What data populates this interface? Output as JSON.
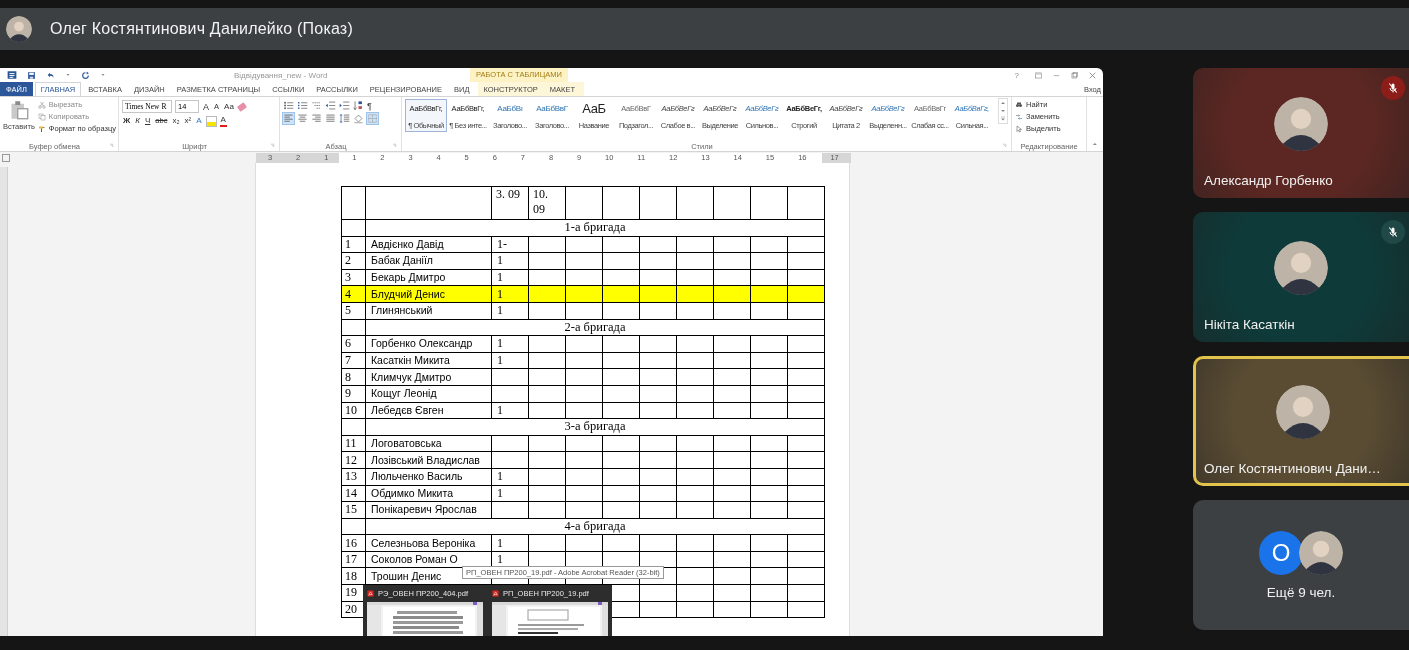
{
  "presenter_bar": {
    "title": "Олег Костянтинович Данилейко (Показ)"
  },
  "word": {
    "title": "Відвідування_new - Word",
    "context_group": "РАБОТА С ТАБЛИЦАМИ",
    "help": "?",
    "sign_in": "Вход",
    "tabs": [
      {
        "label": "ФАЙЛ",
        "kind": "file",
        "selected": false
      },
      {
        "label": "ГЛАВНАЯ",
        "kind": "normal",
        "selected": true
      },
      {
        "label": "ВСТАВКА",
        "kind": "normal",
        "selected": false
      },
      {
        "label": "ДИЗАЙН",
        "kind": "normal",
        "selected": false
      },
      {
        "label": "РАЗМЕТКА СТРАНИЦЫ",
        "kind": "normal",
        "selected": false
      },
      {
        "label": "ССЫЛКИ",
        "kind": "normal",
        "selected": false
      },
      {
        "label": "РАССЫЛКИ",
        "kind": "normal",
        "selected": false
      },
      {
        "label": "РЕЦЕНЗИРОВАНИЕ",
        "kind": "normal",
        "selected": false
      },
      {
        "label": "ВИД",
        "kind": "normal",
        "selected": false
      },
      {
        "label": "КОНСТРУКТОР",
        "kind": "context",
        "selected": false
      },
      {
        "label": "МАКЕТ",
        "kind": "context",
        "selected": false
      }
    ],
    "clipboard": {
      "paste": "Вставить",
      "cut": "Вырезать",
      "copy": "Копировать",
      "format_painter": "Формат по образцу",
      "label": "Буфер обмена"
    },
    "font": {
      "name": "Times New R",
      "size": "14",
      "label": "Шрифт",
      "top_buttons": [
        {
          "label": "A",
          "kind": "grow"
        },
        {
          "label": "A",
          "kind": "shrink"
        },
        {
          "label": "Аа",
          "kind": "case"
        }
      ],
      "buttons": [
        {
          "label": "Ж",
          "kind": "bold"
        },
        {
          "label": "К",
          "kind": "italic"
        },
        {
          "label": "Ч",
          "kind": "underline"
        },
        {
          "label": "abc",
          "kind": "strike"
        },
        {
          "label": "x₂",
          "kind": "sub"
        },
        {
          "label": "x²",
          "kind": "sup"
        },
        {
          "label": "A",
          "kind": "effects"
        },
        {
          "label": "A",
          "kind": "color"
        }
      ]
    },
    "paragraph": {
      "label": "Абзац",
      "pilcrow": "¶"
    },
    "styles": {
      "label": "Стили",
      "items": [
        {
          "sample": "АаБбВвГг,",
          "name": "¶ Обычный",
          "selected": true,
          "kind": "plain"
        },
        {
          "sample": "АаБбВвГг,",
          "name": "¶ Без инте...",
          "selected": false,
          "kind": "plain"
        },
        {
          "sample": "АаБбВı",
          "name": "Заголово...",
          "selected": false,
          "kind": "heading"
        },
        {
          "sample": "АаБбВвГ",
          "name": "Заголово...",
          "selected": false,
          "kind": "heading"
        },
        {
          "sample": "АаБ",
          "name": "Название",
          "selected": false,
          "kind": "title"
        },
        {
          "sample": "АаБбВвГ",
          "name": "Подзагол...",
          "selected": false,
          "kind": "subtle"
        },
        {
          "sample": "АаБбВеГг",
          "name": "Слабое в...",
          "selected": false,
          "kind": "italic"
        },
        {
          "sample": "АаБбВеГг",
          "name": "Выделение",
          "selected": false,
          "kind": "italic"
        },
        {
          "sample": "АаБбВеГг",
          "name": "Сильнов...",
          "selected": false,
          "kind": "accent"
        },
        {
          "sample": "АаБбВеГг,",
          "name": "Строгий",
          "selected": false,
          "kind": "strong"
        },
        {
          "sample": "АаБбВеГг",
          "name": "Цитата 2",
          "selected": false,
          "kind": "italic"
        },
        {
          "sample": "АаБбВеГг",
          "name": "Выделенн...",
          "selected": false,
          "kind": "accent"
        },
        {
          "sample": "АаБбВвГг",
          "name": "Слабая сс...",
          "selected": false,
          "kind": "subtle"
        },
        {
          "sample": "АаБбВвГг,",
          "name": "Сильная...",
          "selected": false,
          "kind": "accent"
        }
      ]
    },
    "editing": {
      "find": "Найти",
      "replace": "Заменить",
      "select": "Выделить",
      "label": "Редактирование"
    },
    "ruler": [
      "3",
      "2",
      "1",
      "1",
      "2",
      "3",
      "4",
      "5",
      "6",
      "7",
      "8",
      "9",
      "10",
      "11",
      "12",
      "13",
      "14",
      "15",
      "16",
      "17"
    ],
    "table": {
      "date_columns": [
        {
          "kind": "date",
          "label": "3. 09"
        },
        {
          "kind": "date",
          "label": "10. 09"
        },
        {
          "kind": "blank"
        },
        {
          "kind": "blank"
        },
        {
          "kind": "blank"
        },
        {
          "kind": "blank"
        },
        {
          "kind": "blank"
        },
        {
          "kind": "blank"
        },
        {
          "kind": "blank"
        }
      ],
      "rows": [
        {
          "kind": "group",
          "title": "1-а бригада"
        },
        {
          "kind": "student",
          "number": "1",
          "name": "Авдієнко Давід",
          "mark": "1-",
          "highlighted": false
        },
        {
          "kind": "student",
          "number": "2",
          "name": "Бабак Даніїл",
          "mark": "1",
          "highlighted": false
        },
        {
          "kind": "student",
          "number": "3",
          "name": "Бекарь Дмитро",
          "mark": "1",
          "highlighted": false
        },
        {
          "kind": "student",
          "number": "4",
          "name": "Блудчий Денис",
          "mark": "1",
          "highlighted": true
        },
        {
          "kind": "student",
          "number": "5",
          "name": "Глинянський",
          "mark": "1",
          "highlighted": false
        },
        {
          "kind": "group",
          "title": "2-а бригада"
        },
        {
          "kind": "student",
          "number": "6",
          "name": "Горбенко Олександр",
          "mark": "1",
          "highlighted": false
        },
        {
          "kind": "student",
          "number": "7",
          "name": "Касаткін Микита",
          "mark": "1",
          "highlighted": false
        },
        {
          "kind": "student",
          "number": "8",
          "name": "Климчук Дмитро",
          "highlighted": false
        },
        {
          "kind": "student",
          "number": "9",
          "name": "Кощуг Леонід",
          "highlighted": false
        },
        {
          "kind": "student",
          "number": "10",
          "name": "Лебедєв Євген",
          "mark": "1",
          "highlighted": false
        },
        {
          "kind": "group",
          "title": "3-а бригада"
        },
        {
          "kind": "student",
          "number": "11",
          "name": "Логоватовська",
          "highlighted": false
        },
        {
          "kind": "student",
          "number": "12",
          "name": "Лозівський Владислав",
          "highlighted": false
        },
        {
          "kind": "student",
          "number": "13",
          "name": "Люльченко Василь",
          "mark": "1",
          "highlighted": false
        },
        {
          "kind": "student",
          "number": "14",
          "name": "Обдимко Микита",
          "mark": "1",
          "highlighted": false
        },
        {
          "kind": "student",
          "number": "15",
          "name": "Понікаревич Ярослав",
          "highlighted": false
        },
        {
          "kind": "group",
          "title": "4-а бригада"
        },
        {
          "kind": "student",
          "number": "16",
          "name": "Селезньова Вероніка",
          "mark": "1",
          "highlighted": false
        },
        {
          "kind": "student",
          "number": "17",
          "name": "Соколов Роман О",
          "mark": "1",
          "highlighted": false
        },
        {
          "kind": "student",
          "number": "18",
          "name": "Трошин Денис",
          "highlighted": false
        },
        {
          "kind": "student",
          "number": "19",
          "highlighted": false
        },
        {
          "kind": "student",
          "number": "20",
          "highlighted": false
        }
      ]
    }
  },
  "taskbar_preview": {
    "tooltip": "РП_ОВЕН ПР200_19.pdf - Adobe Acrobat Reader (32-bit)",
    "windows": [
      {
        "title": "РЭ_ОВЕН ПР200_404.pdf"
      },
      {
        "title": "РП_ОВЕН ПР200_19.pdf"
      }
    ]
  },
  "participants": [
    {
      "name": "Александр Горбенко",
      "color": "#5c2722",
      "mic": {
        "muted": true,
        "color": "#8c1d18"
      },
      "active": false
    },
    {
      "name": "Нікіта Касаткін",
      "color": "#0e3a39",
      "mic": {
        "muted": true,
        "color": "#1f4847"
      },
      "active": false
    },
    {
      "name": "Олег Костянтинович Дани…",
      "color": "#5a4c33",
      "mic": {
        "muted": false
      },
      "active": true
    }
  ],
  "others": {
    "label": "Ещё 9 чел.",
    "avatars": [
      {
        "kind": "letter",
        "letter": "О",
        "color": "#1a73e8"
      },
      {
        "kind": "picture"
      }
    ]
  }
}
